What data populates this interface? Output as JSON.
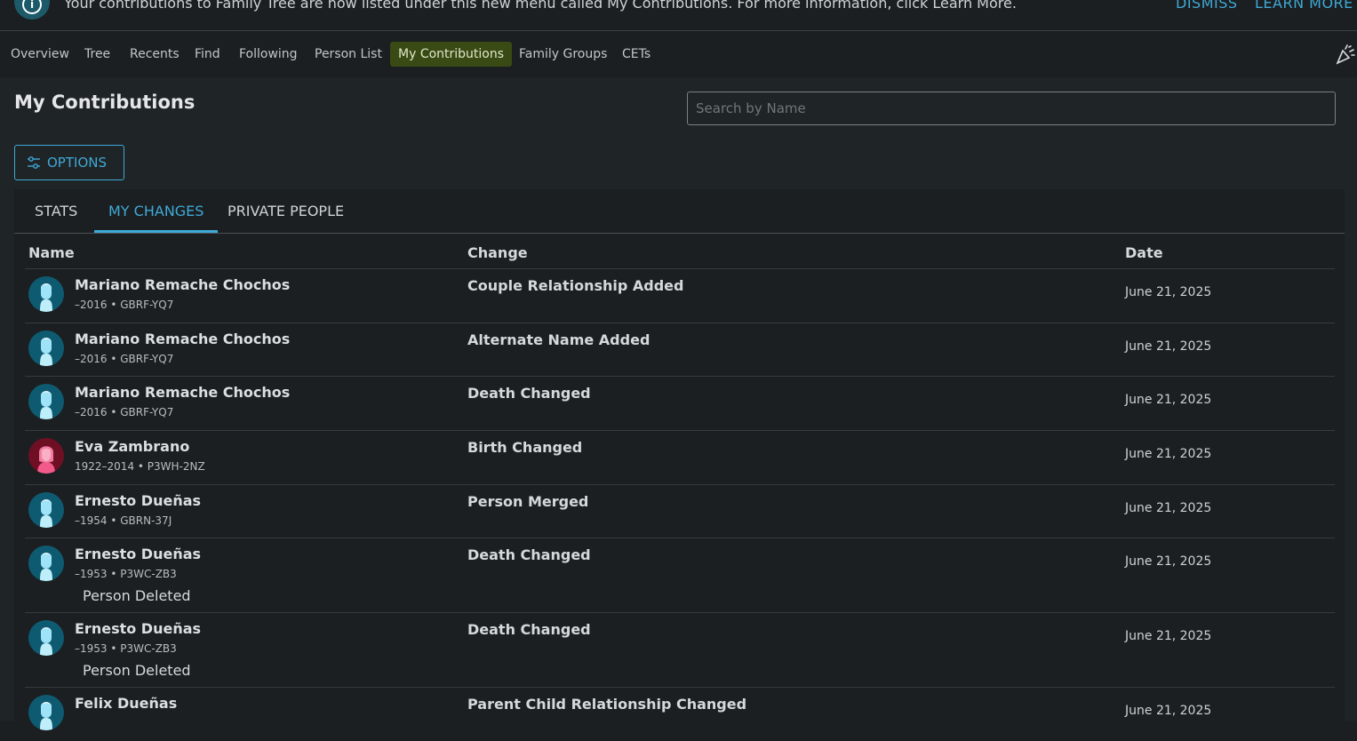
{
  "banner": {
    "text": "Your contributions to Family Tree are now listed under this new menu called My Contributions. For more information, click Learn More.",
    "dismiss_label": "DISMISS",
    "learn_more_label": "LEARN MORE"
  },
  "nav": {
    "items": [
      "Overview",
      "Tree",
      "Recents",
      "Find",
      "Following",
      "Person List",
      "My Contributions",
      "Family Groups",
      "CETs"
    ],
    "active": "My Contributions"
  },
  "page": {
    "title": "My Contributions",
    "search_placeholder": "Search by Name",
    "options_label": "OPTIONS"
  },
  "tabs": {
    "items": [
      "STATS",
      "MY CHANGES",
      "PRIVATE PEOPLE"
    ],
    "active": "MY CHANGES"
  },
  "table": {
    "headers": {
      "name": "Name",
      "change": "Change",
      "date": "Date"
    },
    "rows": [
      {
        "name": "Mariano Remache Chochos",
        "meta": "–2016 • GBRF-YQ7",
        "change": "Couple Relationship Added",
        "date": "June 21, 2025",
        "gender": "male",
        "note": ""
      },
      {
        "name": "Mariano Remache Chochos",
        "meta": "–2016 • GBRF-YQ7",
        "change": "Alternate Name Added",
        "date": "June 21, 2025",
        "gender": "male",
        "note": ""
      },
      {
        "name": "Mariano Remache Chochos",
        "meta": "–2016 • GBRF-YQ7",
        "change": "Death Changed",
        "date": "June 21, 2025",
        "gender": "male",
        "note": ""
      },
      {
        "name": "Eva Zambrano",
        "meta": "1922–2014 • P3WH-2NZ",
        "change": "Birth Changed",
        "date": "June 21, 2025",
        "gender": "female",
        "note": ""
      },
      {
        "name": "Ernesto Dueñas",
        "meta": "–1954 • GBRN-37J",
        "change": "Person Merged",
        "date": "June 21, 2025",
        "gender": "male",
        "note": ""
      },
      {
        "name": "Ernesto Dueñas",
        "meta": "–1953 • P3WC-ZB3",
        "change": "Death Changed",
        "date": "June 21, 2025",
        "gender": "male",
        "note": "Person Deleted"
      },
      {
        "name": "Ernesto Dueñas",
        "meta": "–1953 • P3WC-ZB3",
        "change": "Death Changed",
        "date": "June 21, 2025",
        "gender": "male",
        "note": "Person Deleted"
      },
      {
        "name": "Felix Dueñas",
        "meta": "",
        "change": "Parent Child Relationship Changed",
        "date": "June 21, 2025",
        "gender": "male",
        "note": ""
      }
    ]
  },
  "colors": {
    "accent": "#3fa9d6",
    "active_nav_bg": "#3a4a14",
    "background": "#1f2426",
    "male_avatar": "#0e5b71",
    "female_avatar": "#6e0f24"
  },
  "icons": {
    "banner": "info-icon",
    "nav_right": "party-popper-icon",
    "options": "sliders-icon",
    "male_avatar": "male-silhouette-icon",
    "female_avatar": "female-silhouette-icon"
  }
}
